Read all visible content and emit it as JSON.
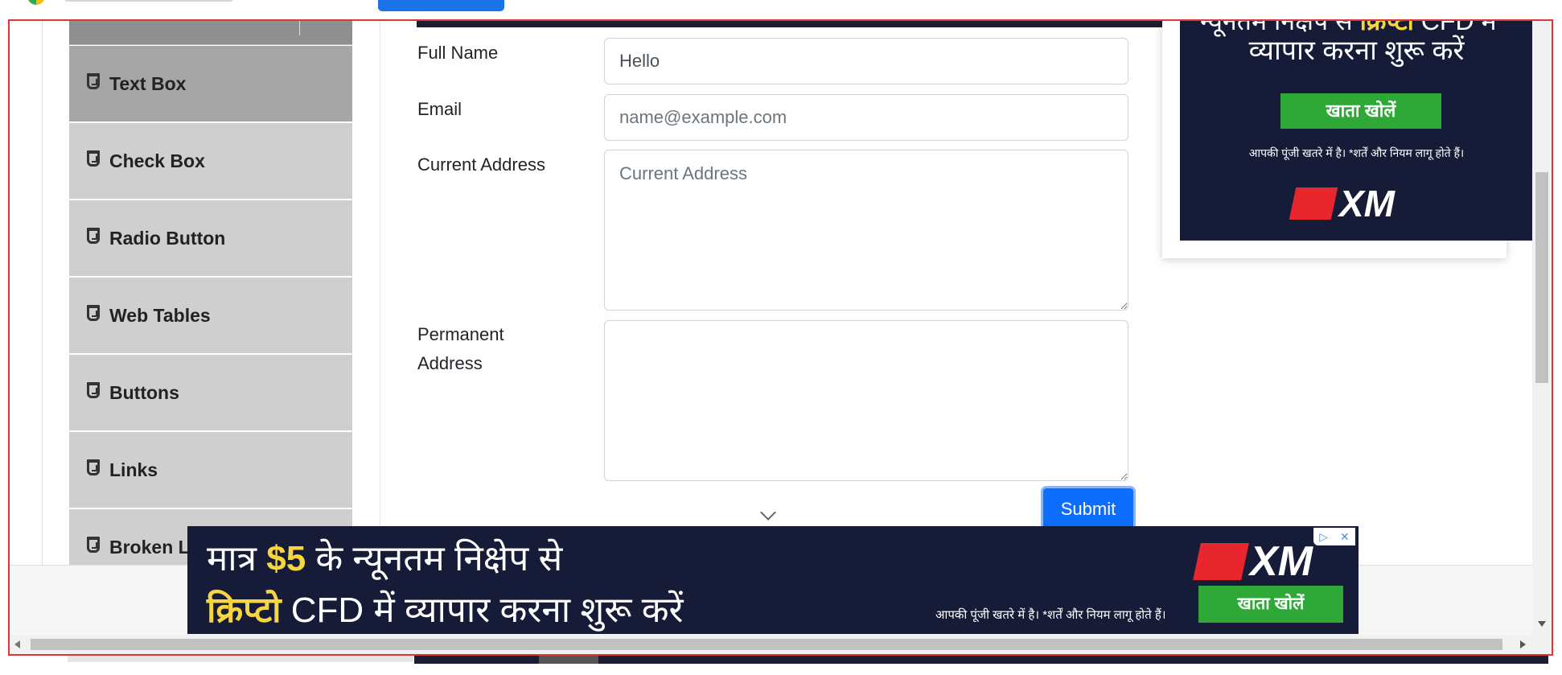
{
  "sidebar": {
    "items": [
      {
        "label": "Text Box",
        "active": true
      },
      {
        "label": "Check Box",
        "active": false
      },
      {
        "label": "Radio Button",
        "active": false
      },
      {
        "label": "Web Tables",
        "active": false
      },
      {
        "label": "Buttons",
        "active": false
      },
      {
        "label": "Links",
        "active": false
      },
      {
        "label": "Broken Links - Images",
        "active": false
      }
    ]
  },
  "form": {
    "full_name": {
      "label": "Full Name",
      "value": "Hello",
      "placeholder": "Full Name"
    },
    "email": {
      "label": "Email",
      "value": "",
      "placeholder": "name@example.com"
    },
    "current_address": {
      "label": "Current Address",
      "value": "",
      "placeholder": "Current Address"
    },
    "permanent_address": {
      "label": "Permanent Address",
      "value": "",
      "placeholder": ""
    },
    "submit_label": "Submit"
  },
  "ad_side": {
    "cropped_line_a": "न्यूनतम निक्षेप से ",
    "cropped_line_b": "क्रिप्टो",
    "cropped_line_c": " CFD में",
    "headline": "व्यापार करना शुरू करें",
    "button": "खाता खोलें",
    "disclaimer": "आपकी पूंजी खतरे में है। *शर्तें और नियम लागू होते हैं।",
    "brand": "XM"
  },
  "ad_bottom": {
    "line1_a": "मात्र ",
    "line1_b": "$5",
    "line1_c": " के न्यूनतम निक्षेप से",
    "line2_a": "क्रिप्टो",
    "line2_b": " CFD में  व्यापार करना शुरू करें",
    "disclaimer": "आपकी पूंजी खतरे में है। *शर्तें और नियम लागू होते हैं।",
    "button": "खाता खोलें",
    "brand": "XM",
    "adchoices": "▷",
    "close": "✕"
  },
  "colors": {
    "accent": "#0d6efd",
    "sidebar_bg": "#cfcfcf",
    "sidebar_active": "#a6a6a6",
    "ad_bg": "#161b38",
    "ad_green": "#2ea836",
    "frame_border": "#e23434"
  }
}
